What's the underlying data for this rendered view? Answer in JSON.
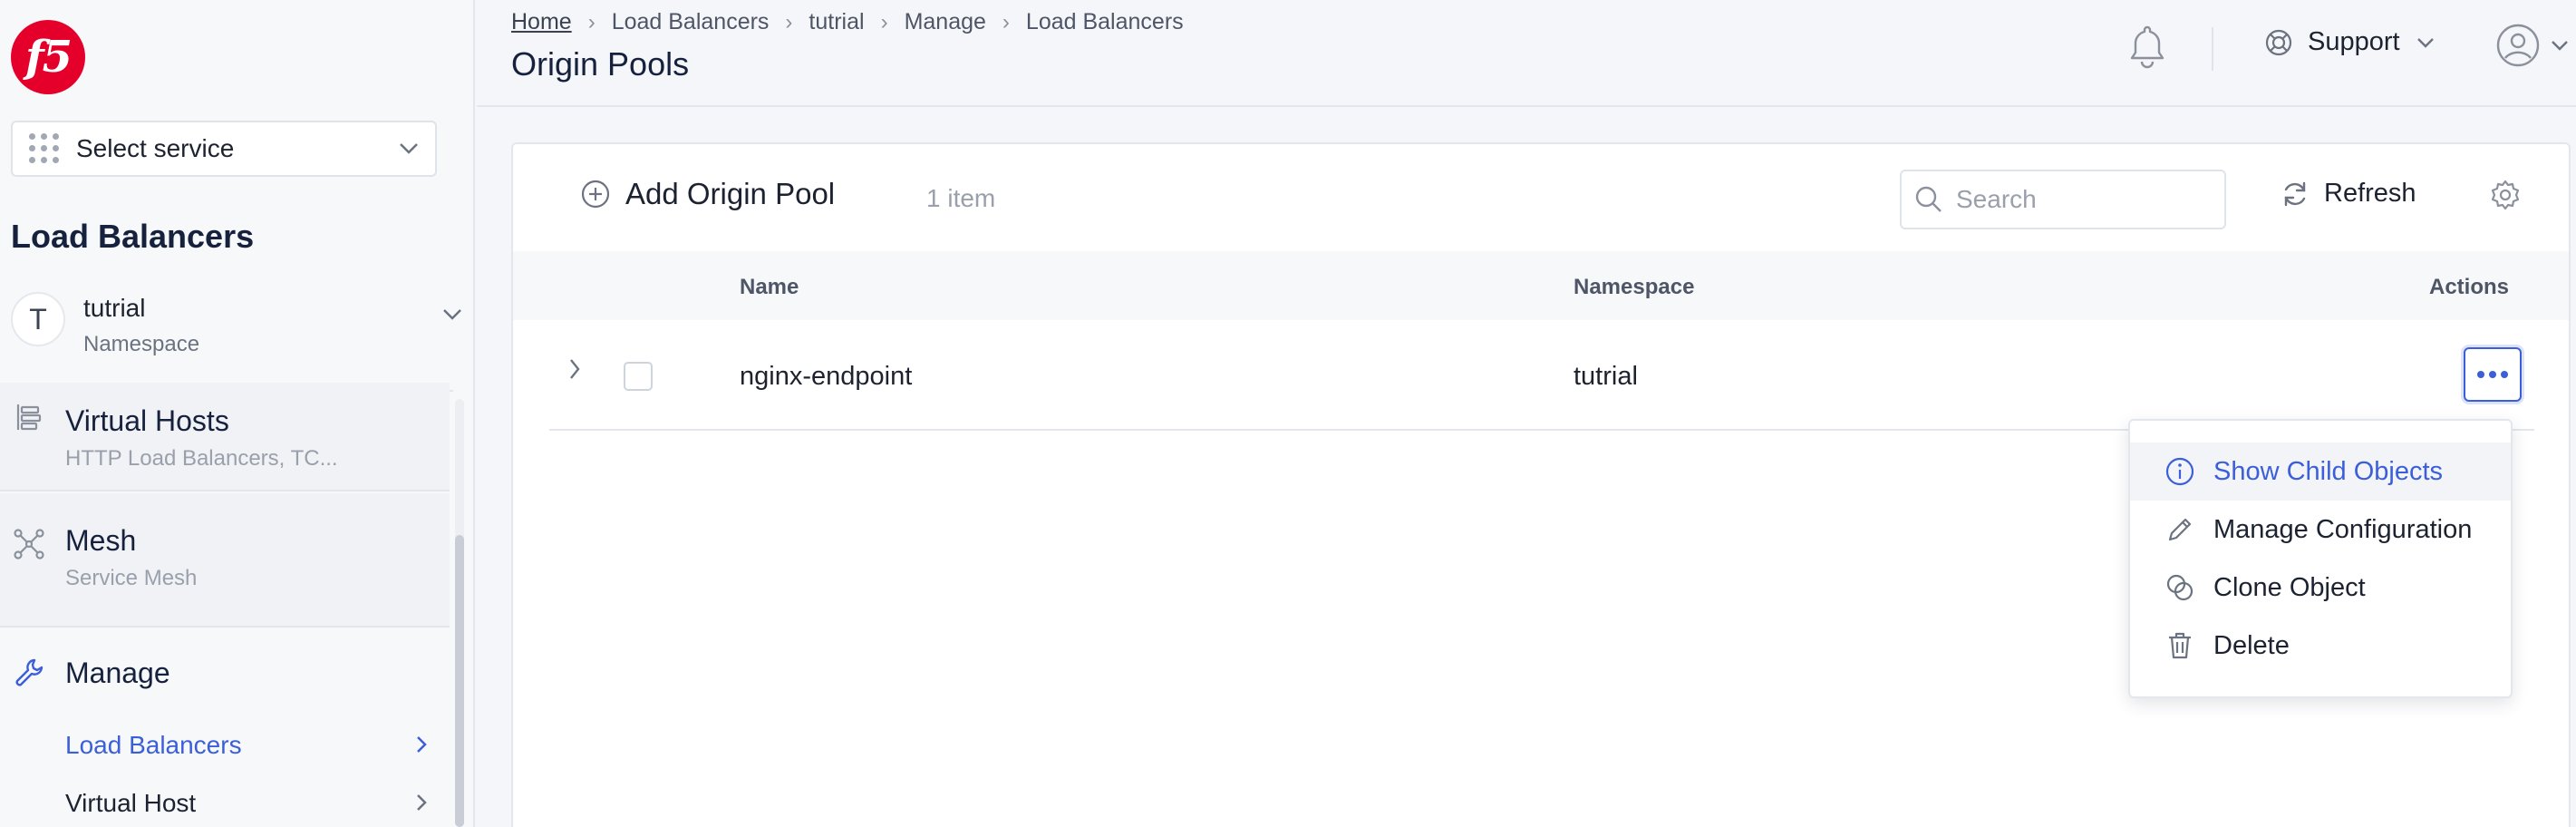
{
  "brand": {
    "logo_text": "f5",
    "accent": "#3b5fd9",
    "logo_color": "#e4002b"
  },
  "sidebar": {
    "service_select": {
      "label": "Select service",
      "icon": "grid-dots-icon"
    },
    "section_title": "Load Balancers",
    "namespace": {
      "avatar": "T",
      "name": "tutrial",
      "label": "Namespace"
    },
    "nav": [
      {
        "title": "Virtual Hosts",
        "subtitle": "HTTP Load Balancers, TC...",
        "icon": "virtual-hosts-icon"
      },
      {
        "title": "Mesh",
        "subtitle": "Service Mesh",
        "icon": "mesh-icon"
      }
    ],
    "manage": {
      "title": "Manage",
      "icon": "wrench-icon",
      "links": [
        {
          "label": "Load Balancers",
          "active": true
        },
        {
          "label": "Virtual Host",
          "active": false
        }
      ]
    }
  },
  "header": {
    "breadcrumb": [
      "Home",
      "Load Balancers",
      "tutrial",
      "Manage",
      "Load Balancers"
    ],
    "title": "Origin Pools",
    "support_label": "Support"
  },
  "toolbar": {
    "add_label": "Add Origin Pool",
    "item_count": "1 item",
    "search_placeholder": "Search",
    "refresh_label": "Refresh"
  },
  "table": {
    "columns": {
      "name": "Name",
      "namespace": "Namespace",
      "actions": "Actions"
    },
    "rows": [
      {
        "name": "nginx-endpoint",
        "namespace": "tutrial"
      }
    ]
  },
  "actions_menu": [
    {
      "label": "Show Child Objects",
      "icon": "info-icon",
      "highlighted": true
    },
    {
      "label": "Manage Configuration",
      "icon": "pencil-icon",
      "highlighted": false
    },
    {
      "label": "Clone Object",
      "icon": "clone-icon",
      "highlighted": false
    },
    {
      "label": "Delete",
      "icon": "trash-icon",
      "highlighted": false
    }
  ]
}
